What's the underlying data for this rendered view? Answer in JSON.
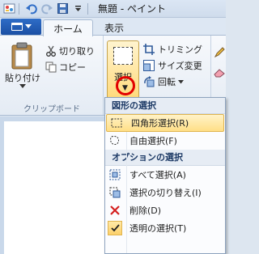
{
  "titlebar": {
    "title": "無題 - ペイント",
    "quick_access": [
      "paint-app-icon",
      "save-icon",
      "undo-icon",
      "redo-icon",
      "customize-arrow-icon"
    ]
  },
  "tabs": {
    "file_menu": "",
    "home": "ホーム",
    "view": "表示"
  },
  "clipboard": {
    "paste": "貼り付け",
    "cut": "切り取り",
    "copy": "コピー",
    "group_label": "クリップボード"
  },
  "image": {
    "select": "選択",
    "crop": "トリミング",
    "resize": "サイズ変更",
    "rotate": "回転"
  },
  "dropdown": {
    "shape_header": "図形の選択",
    "shape_items": [
      {
        "label": "四角形選択(R)",
        "icon": "rectangle-select-icon"
      },
      {
        "label": "自由選択(F)",
        "icon": "free-form-select-icon"
      }
    ],
    "options_header": "オプションの選択",
    "option_items": [
      {
        "label": "すべて選択(A)",
        "icon": "select-all-icon"
      },
      {
        "label": "選択の切り替え(I)",
        "icon": "invert-selection-icon"
      },
      {
        "label": "削除(D)",
        "icon": "delete-icon"
      },
      {
        "label": "透明の選択(T)",
        "icon": "checkmark-icon"
      }
    ]
  },
  "colors": {
    "accent_blue": "#1b4fa4",
    "hover_yellow": "#ffdf87",
    "highlight_red": "#e20000"
  }
}
